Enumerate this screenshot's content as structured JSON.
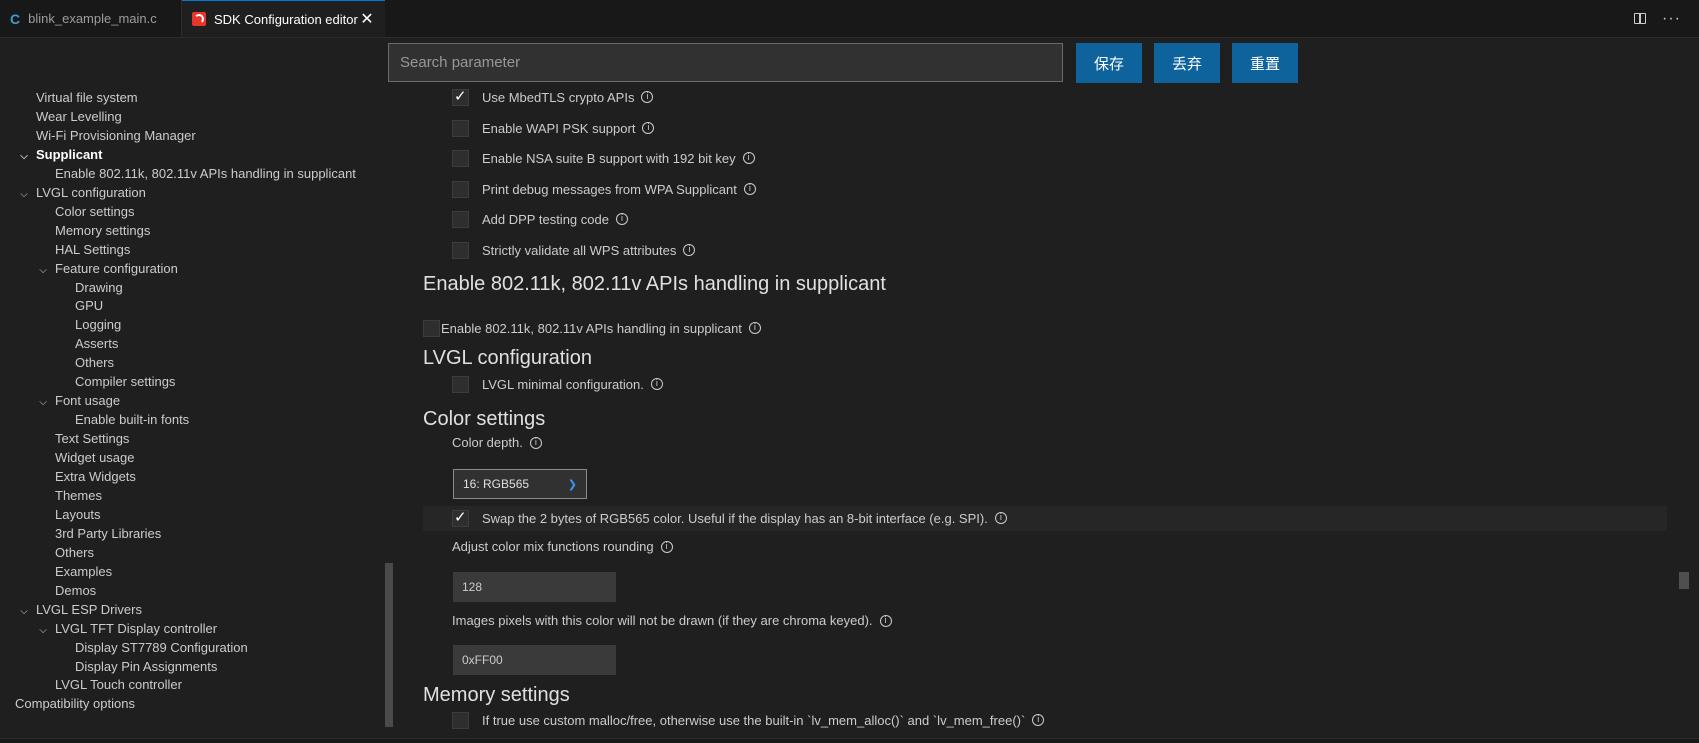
{
  "tabs": [
    {
      "label": "blink_example_main.c",
      "icon": "c-file-icon"
    },
    {
      "label": "SDK Configuration editor",
      "icon": "espressif-icon",
      "active": true
    }
  ],
  "toolbar": {
    "search_placeholder": "Search parameter",
    "save_label": "保存",
    "discard_label": "丢弃",
    "reset_label": "重置"
  },
  "sidebar": {
    "items": [
      {
        "label": "Virtual file system",
        "level": 1,
        "expanded": null,
        "bold": false
      },
      {
        "label": "Wear Levelling",
        "level": 1,
        "expanded": null,
        "bold": false
      },
      {
        "label": "Wi-Fi Provisioning Manager",
        "level": 1,
        "expanded": null,
        "bold": false
      },
      {
        "label": "Supplicant",
        "level": 1,
        "expanded": true,
        "bold": true
      },
      {
        "label": "Enable 802.11k, 802.11v APIs handling in supplicant",
        "level": 2,
        "expanded": null,
        "bold": false
      },
      {
        "label": "LVGL configuration",
        "level": 1,
        "expanded": true,
        "bold": false
      },
      {
        "label": "Color settings",
        "level": 2,
        "expanded": null,
        "bold": false
      },
      {
        "label": "Memory settings",
        "level": 2,
        "expanded": null,
        "bold": false
      },
      {
        "label": "HAL Settings",
        "level": 2,
        "expanded": null,
        "bold": false
      },
      {
        "label": "Feature configuration",
        "level": 2,
        "expanded": true,
        "bold": false
      },
      {
        "label": "Drawing",
        "level": 3,
        "expanded": null,
        "bold": false
      },
      {
        "label": "GPU",
        "level": 3,
        "expanded": null,
        "bold": false
      },
      {
        "label": "Logging",
        "level": 3,
        "expanded": null,
        "bold": false
      },
      {
        "label": "Asserts",
        "level": 3,
        "expanded": null,
        "bold": false
      },
      {
        "label": "Others",
        "level": 3,
        "expanded": null,
        "bold": false
      },
      {
        "label": "Compiler settings",
        "level": 3,
        "expanded": null,
        "bold": false
      },
      {
        "label": "Font usage",
        "level": 2,
        "expanded": true,
        "bold": false
      },
      {
        "label": "Enable built-in fonts",
        "level": 3,
        "expanded": null,
        "bold": false
      },
      {
        "label": "Text Settings",
        "level": 2,
        "expanded": null,
        "bold": false
      },
      {
        "label": "Widget usage",
        "level": 2,
        "expanded": null,
        "bold": false
      },
      {
        "label": "Extra Widgets",
        "level": 2,
        "expanded": null,
        "bold": false
      },
      {
        "label": "Themes",
        "level": 2,
        "expanded": null,
        "bold": false
      },
      {
        "label": "Layouts",
        "level": 2,
        "expanded": null,
        "bold": false
      },
      {
        "label": "3rd Party Libraries",
        "level": 2,
        "expanded": null,
        "bold": false
      },
      {
        "label": "Others",
        "level": 2,
        "expanded": null,
        "bold": false
      },
      {
        "label": "Examples",
        "level": 2,
        "expanded": null,
        "bold": false
      },
      {
        "label": "Demos",
        "level": 2,
        "expanded": null,
        "bold": false
      },
      {
        "label": "LVGL ESP Drivers",
        "level": 1,
        "expanded": true,
        "bold": false
      },
      {
        "label": "LVGL TFT Display controller",
        "level": 2,
        "expanded": true,
        "bold": false
      },
      {
        "label": "Display ST7789 Configuration",
        "level": 3,
        "expanded": null,
        "bold": false
      },
      {
        "label": "Display Pin Assignments",
        "level": 3,
        "expanded": null,
        "bold": false
      },
      {
        "label": "LVGL Touch controller",
        "level": 2,
        "expanded": null,
        "bold": false
      },
      {
        "label": "Compatibility options",
        "level": 0,
        "expanded": null,
        "bold": false
      }
    ]
  },
  "main": {
    "supplicant_options": [
      {
        "label": "Use MbedTLS crypto APIs",
        "checked": true
      },
      {
        "label": "Enable WAPI PSK support",
        "checked": false
      },
      {
        "label": "Enable NSA suite B support with 192 bit key",
        "checked": false
      },
      {
        "label": "Print debug messages from WPA Supplicant",
        "checked": false
      },
      {
        "label": "Add DPP testing code",
        "checked": false
      },
      {
        "label": "Strictly validate all WPS attributes",
        "checked": false
      }
    ],
    "section_80211": {
      "title": "Enable 802.11k, 802.11v APIs handling in supplicant",
      "option": {
        "label": "Enable 802.11k, 802.11v APIs handling in supplicant",
        "checked": false
      }
    },
    "section_lvgl": {
      "title": "LVGL configuration",
      "option": {
        "label": "LVGL minimal configuration.",
        "checked": false
      }
    },
    "section_color": {
      "title": "Color settings",
      "color_depth_label": "Color depth.",
      "color_depth_value": "16: RGB565",
      "swap_label": "Swap the 2 bytes of RGB565 color. Useful if the display has an 8-bit interface (e.g. SPI).",
      "swap_checked": true,
      "mix_label": "Adjust color mix functions rounding",
      "mix_value": "128",
      "chroma_label": "Images pixels with this color will not be drawn (if they are chroma keyed).",
      "chroma_value": "0xFF00"
    },
    "section_memory": {
      "title": "Memory settings",
      "option": {
        "label": "If true use custom malloc/free, otherwise use the built-in `lv_mem_alloc()` and `lv_mem_free()`",
        "checked": false
      }
    }
  }
}
